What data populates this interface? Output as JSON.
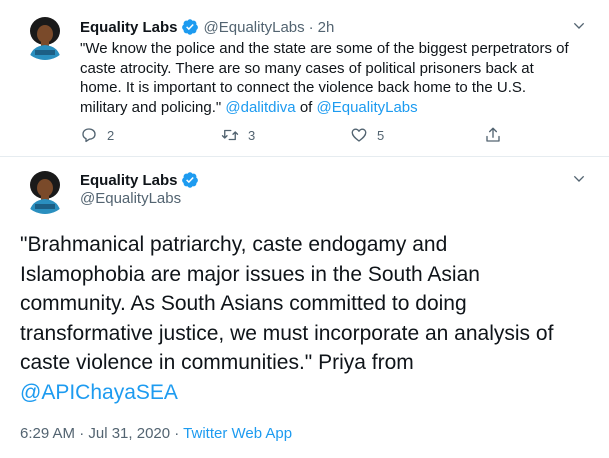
{
  "colors": {
    "accent": "#1d9bf0",
    "muted": "#536471",
    "text": "#0f1419"
  },
  "tweet1": {
    "author_name": "Equality Labs",
    "handle": "@EqualityLabs",
    "separator": "·",
    "time": "2h",
    "text_lines": [
      "\"We know the police and the state are some of the biggest perpetrators of",
      "caste atrocity. There are so many cases of political prisoners back at",
      "home. It is important to connect the violence back home to the U.S."
    ],
    "last_line_text": "military and policing.\" ",
    "mention1": "@dalitdiva",
    "of_text": " of ",
    "mention2": "@EqualityLabs",
    "replies": "2",
    "retweets": "3",
    "likes": "5",
    "icons": [
      "verified-badge-icon",
      "chevron-down-icon",
      "reply-icon",
      "retweet-icon",
      "like-icon",
      "share-icon"
    ]
  },
  "tweet2": {
    "author_name": "Equality Labs",
    "handle": "@EqualityLabs",
    "text_lines": [
      "\"Brahmanical patriarchy, caste endogamy and",
      "Islamophobia are major issues in the South Asian",
      "community. As South Asians committed to doing",
      "transformative justice, we must incorporate an analysis of",
      "caste violence in communities.\" Priya from"
    ],
    "mention": "@APIChayaSEA",
    "timestamp": "6:29 AM · Jul 31, 2020",
    "separator": " · ",
    "source": "Twitter Web App"
  }
}
